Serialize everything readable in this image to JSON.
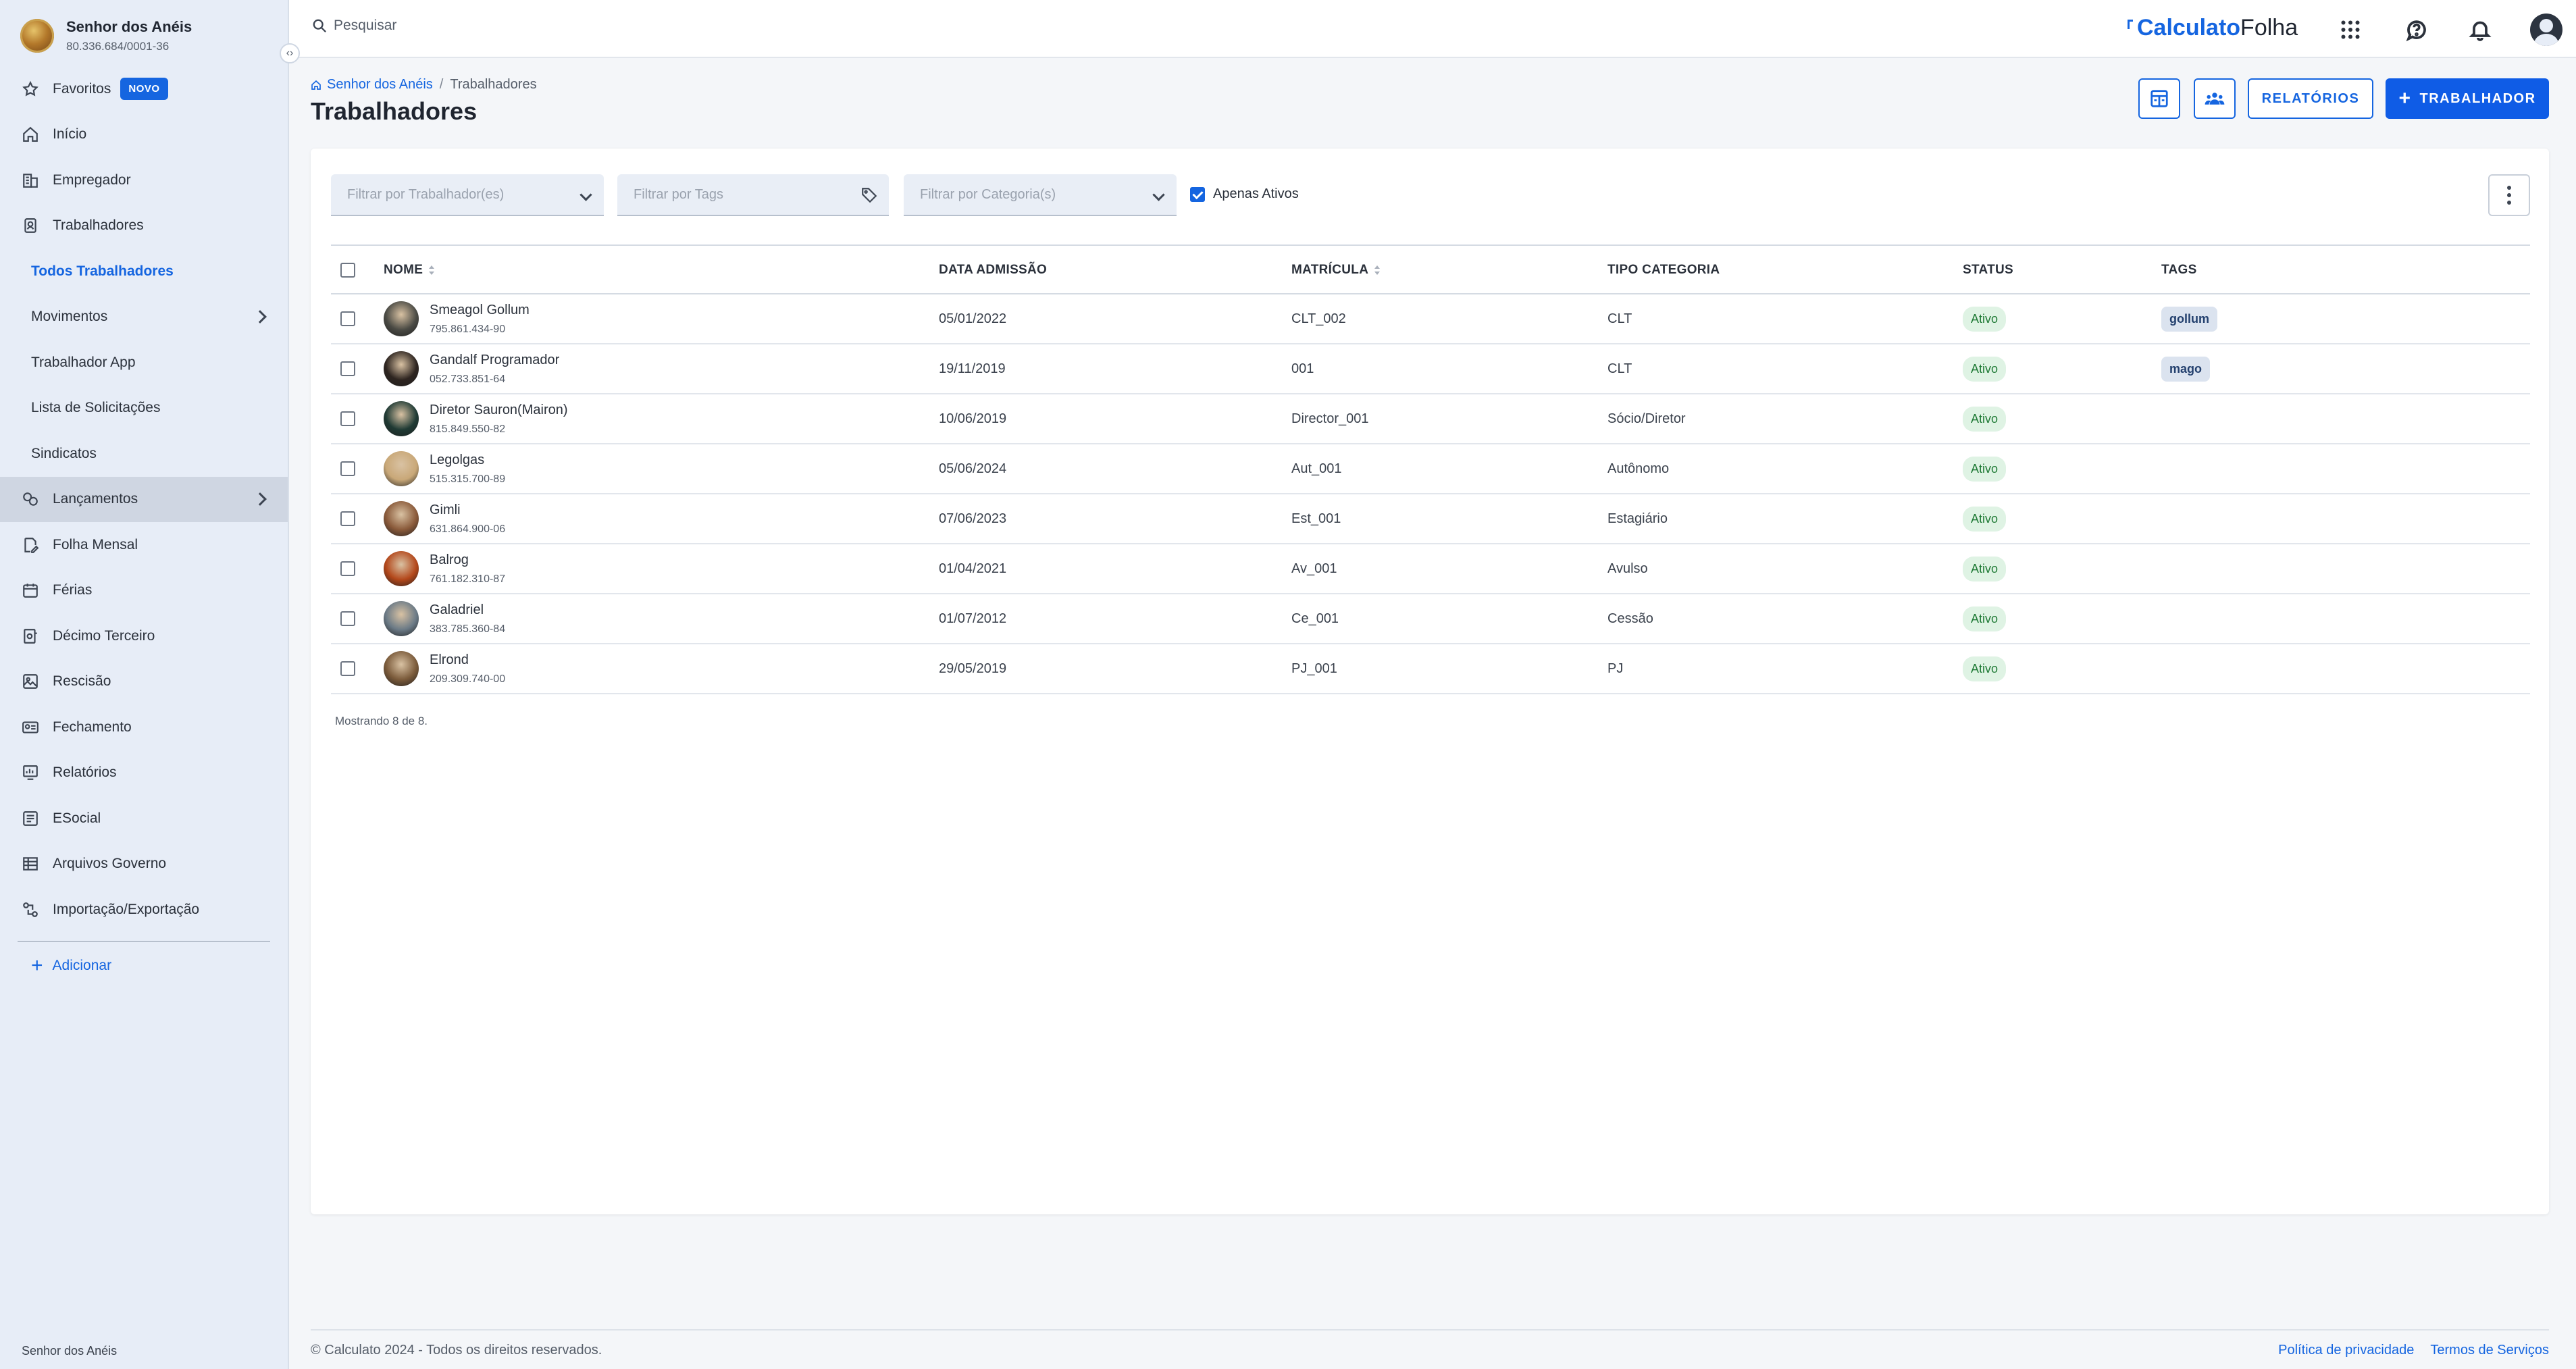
{
  "company": {
    "name": "Senhor dos Anéis",
    "cnpj": "80.336.684/0001-36"
  },
  "sidebar": {
    "collapse_icon": "‹›",
    "items": [
      {
        "label": "Favoritos",
        "icon": "star-icon",
        "badge": "NOVO"
      },
      {
        "label": "Início",
        "icon": "home-icon"
      },
      {
        "label": "Empregador",
        "icon": "building-icon"
      },
      {
        "label": "Trabalhadores",
        "icon": "badge-icon"
      },
      {
        "label": "Todos Trabalhadores",
        "sub": true,
        "active": true
      },
      {
        "label": "Movimentos",
        "sub": true,
        "chevron": true
      },
      {
        "label": "Trabalhador App",
        "sub": true
      },
      {
        "label": "Lista de Solicitações",
        "sub": true
      },
      {
        "label": "Sindicatos",
        "sub": true
      },
      {
        "label": "Lançamentos",
        "icon": "coins-icon",
        "chevron": true,
        "hover": true
      },
      {
        "label": "Folha Mensal",
        "icon": "edit-doc-icon"
      },
      {
        "label": "Férias",
        "icon": "calendar-icon"
      },
      {
        "label": "Décimo Terceiro",
        "icon": "money-doc-icon"
      },
      {
        "label": "Rescisão",
        "icon": "image-doc-icon"
      },
      {
        "label": "Fechamento",
        "icon": "id-card-icon"
      },
      {
        "label": "Relatórios",
        "icon": "report-icon"
      },
      {
        "label": "ESocial",
        "icon": "esocial-doc-icon"
      },
      {
        "label": "Arquivos Governo",
        "icon": "table-icon"
      },
      {
        "label": "Importação/Exportação",
        "icon": "transfer-icon"
      }
    ],
    "add_label": "Adicionar",
    "footer": "Senhor dos Anéis"
  },
  "topbar": {
    "search_placeholder": "Pesquisar",
    "brand_part1": "Calculato",
    "brand_part2": "Folha"
  },
  "page": {
    "breadcrumb_root": "Senhor dos Anéis",
    "breadcrumb_sep": "/",
    "breadcrumb_current": "Trabalhadores",
    "title": "Trabalhadores",
    "btn_relatorios": "RELATÓRIOS",
    "btn_add": "TRABALHADOR",
    "btn_add_icon": "+"
  },
  "filters": {
    "workers_placeholder": "Filtrar por Trabalhador(es)",
    "tags_placeholder": "Filtrar por Tags",
    "category_placeholder": "Filtrar por Categoria(s)",
    "only_active_label": "Apenas Ativos",
    "only_active_checked": true
  },
  "table": {
    "columns": [
      "NOME",
      "DATA ADMISSÃO",
      "MATRÍCULA",
      "TIPO CATEGORIA",
      "STATUS",
      "TAGS"
    ],
    "rows": [
      {
        "name": "Smeagol Gollum",
        "cpf": "795.861.434-90",
        "date": "05/01/2022",
        "mat": "CLT_002",
        "cat": "CLT",
        "status": "Ativo",
        "tag": "gollum",
        "avatar": "#4a4a44"
      },
      {
        "name": "Gandalf Programador",
        "cpf": "052.733.851-64",
        "date": "19/11/2019",
        "mat": "001",
        "cat": "CLT",
        "status": "Ativo",
        "tag": "mago",
        "avatar": "#2e2520"
      },
      {
        "name": "Diretor Sauron(Mairon)",
        "cpf": "815.849.550-82",
        "date": "10/06/2019",
        "mat": "Director_001",
        "cat": "Sócio/Diretor",
        "status": "Ativo",
        "tag": "",
        "avatar": "#1f3a34"
      },
      {
        "name": "Legolgas",
        "cpf": "515.315.700-89",
        "date": "05/06/2024",
        "mat": "Aut_001",
        "cat": "Autônomo",
        "status": "Ativo",
        "tag": "",
        "avatar": "#c9a878"
      },
      {
        "name": "Gimli",
        "cpf": "631.864.900-06",
        "date": "07/06/2023",
        "mat": "Est_001",
        "cat": "Estagiário",
        "status": "Ativo",
        "tag": "",
        "avatar": "#8a5a3a"
      },
      {
        "name": "Balrog",
        "cpf": "761.182.310-87",
        "date": "01/04/2021",
        "mat": "Av_001",
        "cat": "Avulso",
        "status": "Ativo",
        "tag": "",
        "avatar": "#b3471a"
      },
      {
        "name": "Galadriel",
        "cpf": "383.785.360-84",
        "date": "01/07/2012",
        "mat": "Ce_001",
        "cat": "Cessão",
        "status": "Ativo",
        "tag": "",
        "avatar": "#6b7a86"
      },
      {
        "name": "Elrond",
        "cpf": "209.309.740-00",
        "date": "29/05/2019",
        "mat": "PJ_001",
        "cat": "PJ",
        "status": "Ativo",
        "tag": "",
        "avatar": "#7a5a3a"
      }
    ],
    "showing": "Mostrando 8 de 8."
  },
  "footer": {
    "copyright": "© Calculato 2024 - Todos os direitos reservados.",
    "privacy": "Política de privacidade",
    "terms": "Termos de Serviços"
  }
}
